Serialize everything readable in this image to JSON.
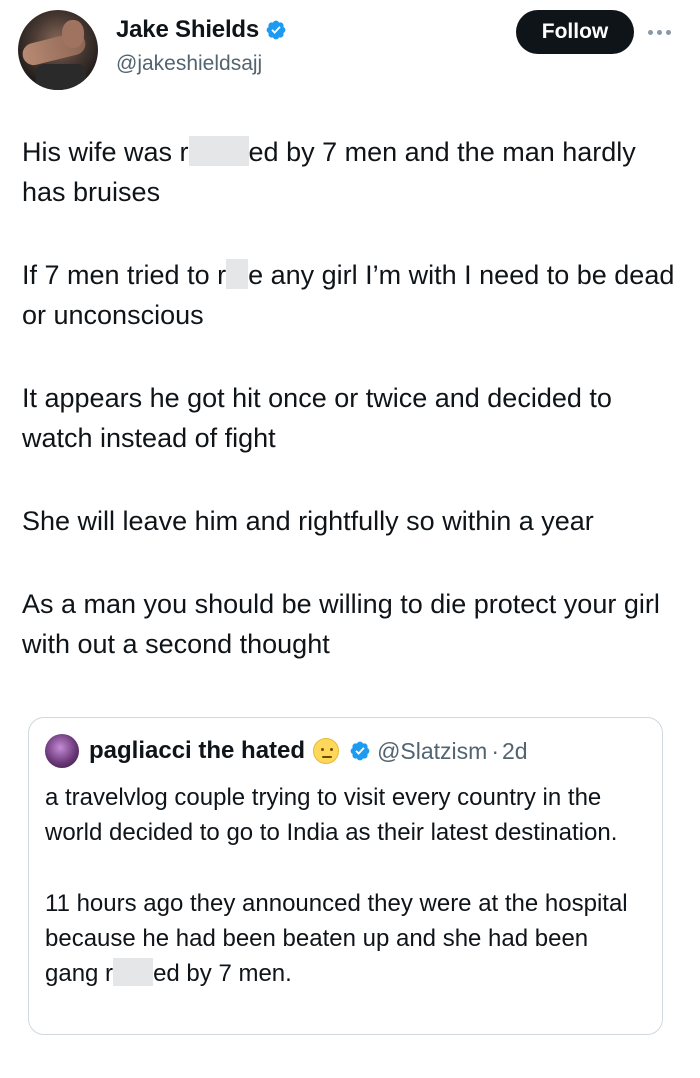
{
  "author": {
    "display_name": "Jake Shields",
    "handle": "@jakeshieldsajj"
  },
  "actions": {
    "follow_label": "Follow"
  },
  "tweet": {
    "p1a": "His wife was r",
    "p1b": "ed by 7 men and the man hardly has bruises",
    "p2a": "If 7 men tried to r",
    "p2b": "e any girl I’m with I need to be dead or unconscious",
    "p3": "It appears he got hit once or twice and decided to watch instead of fight",
    "p4": "She will leave him and rightfully so within a year",
    "p5": "As a man you should be willing to die protect your girl with out a second thought"
  },
  "quote": {
    "display_name": "pagliacci the hated",
    "handle": "@Slatzism",
    "separator": "·",
    "time": "2d",
    "p1": "a travelvlog couple trying to visit every country in the world decided to go to India as their latest destination.",
    "p2a": "11 hours ago they announced they were at the hospital because he had been beaten up and she had been gang r",
    "p2b": "ed by 7 men."
  },
  "colors": {
    "verified_blue": "#1d9bf0",
    "text_primary": "#0f1419",
    "text_secondary": "#536471",
    "redaction": "#e4e6e8"
  },
  "icons": [
    "verified-badge-icon",
    "more-options-icon",
    "slightly-frowning-face-emoji"
  ]
}
